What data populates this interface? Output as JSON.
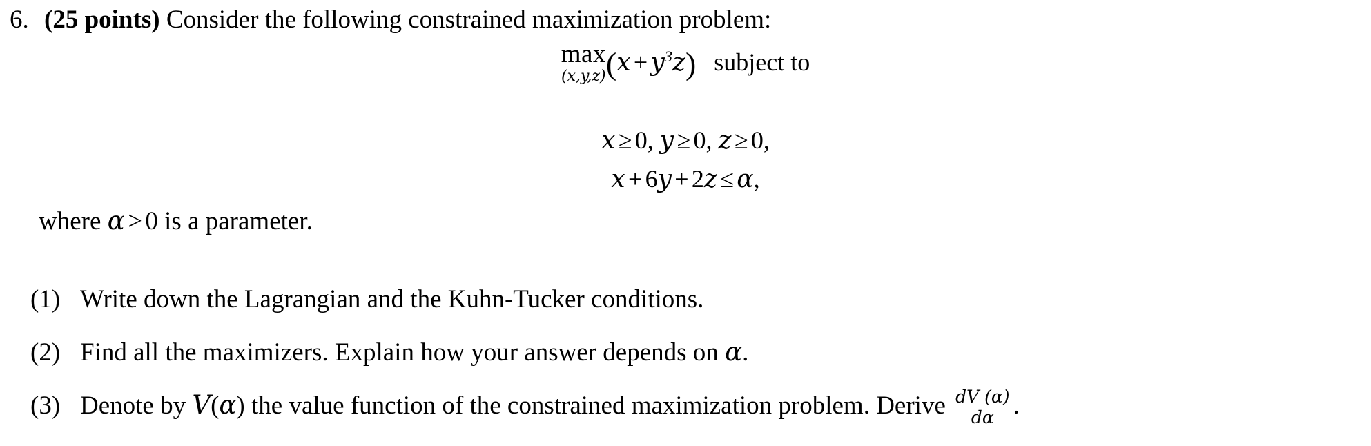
{
  "problem": {
    "number": "6.",
    "points_label": "(25 points)",
    "statement": "Consider the following constrained maximization problem:"
  },
  "display_math": {
    "objective": {
      "operator": "max",
      "operator_subscript": "(x,y,z)",
      "open_paren": "(",
      "expr_var1": "x",
      "plus": "+",
      "expr_var2": "y",
      "exponent": "3",
      "expr_var3": "z",
      "close_paren": ")",
      "subject_to": "subject to",
      "plain": "max_{(x,y,z)} (x + y^3 z)  subject to"
    },
    "nonnegativity": {
      "plain": "x ≥ 0, y ≥ 0, z ≥ 0,",
      "x_var": "x",
      "y_var": "y",
      "z_var": "z",
      "geq": "≥",
      "zero": "0",
      "comma": ",",
      "comma_space": ", "
    },
    "budget": {
      "plain": "x + 6y + 2z ≤ α,",
      "x_var": "x",
      "plus": "+",
      "coef_y": "6",
      "y_var": "y",
      "coef_z": "2",
      "z_var": "z",
      "leq": "≤",
      "alpha": "α",
      "comma": ","
    }
  },
  "where_clause": {
    "prefix": "where ",
    "alpha": "α",
    "gt": ">",
    "zero": "0",
    "suffix": " is a parameter.",
    "plain": "where α > 0 is a parameter."
  },
  "parts": [
    {
      "marker": "(1)",
      "text": "Write down the Lagrangian and the Kuhn-Tucker conditions."
    },
    {
      "marker": "(2)",
      "text_before": "Find all the maximizers. Explain how your answer depends on ",
      "alpha": "α",
      "text_after": ".",
      "plain": "Find all the maximizers. Explain how your answer depends on α."
    },
    {
      "marker": "(3)",
      "text_before": "Denote by ",
      "value_fn": "V",
      "value_fn_open": "(",
      "alpha": "α",
      "value_fn_close": ")",
      "text_middle": " the value function of the constrained maximization problem. Derive ",
      "derivative_numerator": "dV (α)",
      "derivative_denominator": "dα",
      "text_after": ".",
      "plain": "Denote by V(α) the value function of the constrained maximization problem. Derive dV(α)/dα."
    }
  ],
  "colors": {
    "background": "#ffffff",
    "text": "#000000"
  }
}
